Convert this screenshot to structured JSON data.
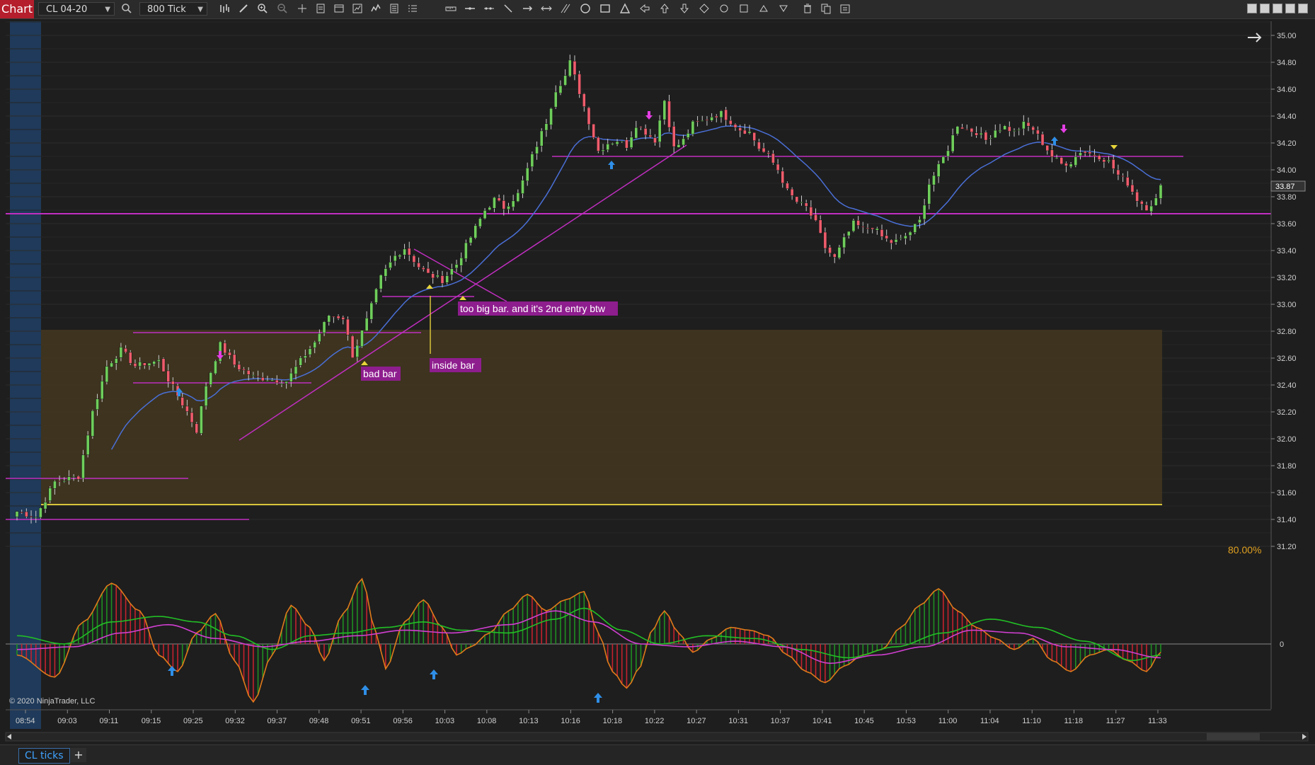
{
  "toolbar": {
    "brand": "Chart",
    "instrument": "CL 04-20",
    "interval": "800 Tick"
  },
  "tabs": [
    {
      "label": "CL ticks"
    }
  ],
  "copyright": "© 2020 NinjaTrader, LLC",
  "percent_label": "80.00%",
  "colors": {
    "background": "#1e1e1e",
    "up_candle": "#6fce5b",
    "down_candle": "#ef5c6c",
    "line_magenta": "#c02ec0",
    "fib_zone": "#3f3520",
    "sma": "#4a6fd6",
    "osc_orange": "#e07a1a",
    "osc_green": "#22c025",
    "osc_magenta": "#d13fd1"
  },
  "chart_data": {
    "type": "candlestick",
    "price_axis": {
      "ticks": [
        "35.00",
        "34.80",
        "34.60",
        "34.40",
        "34.20",
        "34.00",
        "33.80",
        "33.60",
        "33.40",
        "33.20",
        "33.00",
        "32.80",
        "32.60",
        "32.40",
        "32.20",
        "32.00",
        "31.80",
        "31.60",
        "31.40",
        "31.20"
      ],
      "range": [
        31.1,
        35.05
      ],
      "current_price": "33.87"
    },
    "time_axis": {
      "labels": [
        "08:54",
        "09:03",
        "09:11",
        "09:15",
        "09:25",
        "09:32",
        "09:37",
        "09:48",
        "09:51",
        "09:56",
        "10:03",
        "10:08",
        "10:13",
        "10:16",
        "10:18",
        "10:22",
        "10:27",
        "10:31",
        "10:37",
        "10:41",
        "10:45",
        "10:53",
        "11:00",
        "11:04",
        "11:10",
        "11:18",
        "11:27",
        "11:33"
      ]
    },
    "close_path": [
      [
        0,
        31.46
      ],
      [
        4,
        31.42
      ],
      [
        8,
        31.68
      ],
      [
        13,
        31.72
      ],
      [
        16,
        32.2
      ],
      [
        19,
        32.54
      ],
      [
        22,
        32.66
      ],
      [
        25,
        32.54
      ],
      [
        27,
        32.56
      ],
      [
        30,
        32.58
      ],
      [
        32,
        32.44
      ],
      [
        36,
        32.2
      ],
      [
        38,
        32.06
      ],
      [
        40,
        32.4
      ],
      [
        43,
        32.7
      ],
      [
        46,
        32.55
      ],
      [
        50,
        32.46
      ],
      [
        54,
        32.44
      ],
      [
        57,
        32.43
      ],
      [
        60,
        32.58
      ],
      [
        63,
        32.72
      ],
      [
        66,
        32.92
      ],
      [
        69,
        32.9
      ],
      [
        71,
        32.62
      ],
      [
        74,
        32.88
      ],
      [
        77,
        33.2
      ],
      [
        80,
        33.36
      ],
      [
        82,
        33.42
      ],
      [
        85,
        33.28
      ],
      [
        87,
        33.22
      ],
      [
        90,
        33.18
      ],
      [
        93,
        33.3
      ],
      [
        96,
        33.5
      ],
      [
        99,
        33.7
      ],
      [
        101,
        33.78
      ],
      [
        103,
        33.72
      ],
      [
        106,
        33.82
      ],
      [
        109,
        34.1
      ],
      [
        112,
        34.36
      ],
      [
        114,
        34.6
      ],
      [
        116,
        34.7
      ],
      [
        117,
        34.8
      ],
      [
        119,
        34.58
      ],
      [
        121,
        34.36
      ],
      [
        123,
        34.14
      ],
      [
        125,
        34.2
      ],
      [
        127,
        34.22
      ],
      [
        129,
        34.18
      ],
      [
        131,
        34.34
      ],
      [
        133,
        34.28
      ],
      [
        135,
        34.22
      ],
      [
        137,
        34.52
      ],
      [
        139,
        34.16
      ],
      [
        141,
        34.22
      ],
      [
        143,
        34.34
      ],
      [
        145,
        34.36
      ],
      [
        147,
        34.4
      ],
      [
        149,
        34.42
      ],
      [
        151,
        34.36
      ],
      [
        153,
        34.3
      ],
      [
        155,
        34.28
      ],
      [
        157,
        34.16
      ],
      [
        159,
        34.1
      ],
      [
        161,
        34.0
      ],
      [
        163,
        33.84
      ],
      [
        165,
        33.76
      ],
      [
        167,
        33.72
      ],
      [
        169,
        33.6
      ],
      [
        171,
        33.42
      ],
      [
        173,
        33.34
      ],
      [
        175,
        33.48
      ],
      [
        177,
        33.6
      ],
      [
        179,
        33.56
      ],
      [
        181,
        33.58
      ],
      [
        183,
        33.5
      ],
      [
        185,
        33.46
      ],
      [
        187,
        33.48
      ],
      [
        189,
        33.54
      ],
      [
        191,
        33.62
      ],
      [
        193,
        33.9
      ],
      [
        195,
        34.02
      ],
      [
        197,
        34.16
      ],
      [
        199,
        34.34
      ],
      [
        201,
        34.3
      ],
      [
        203,
        34.28
      ],
      [
        205,
        34.22
      ],
      [
        207,
        34.3
      ],
      [
        209,
        34.32
      ],
      [
        211,
        34.28
      ],
      [
        213,
        34.34
      ],
      [
        215,
        34.3
      ],
      [
        217,
        34.2
      ],
      [
        219,
        34.1
      ],
      [
        221,
        34.04
      ],
      [
        223,
        34.06
      ],
      [
        225,
        34.14
      ],
      [
        227,
        34.12
      ],
      [
        229,
        34.1
      ],
      [
        231,
        34.06
      ],
      [
        233,
        33.96
      ],
      [
        235,
        33.9
      ],
      [
        237,
        33.78
      ],
      [
        239,
        33.72
      ],
      [
        241,
        33.78
      ],
      [
        242,
        33.87
      ]
    ],
    "oscillator": {
      "zero_label": "0",
      "osc_points": [
        [
          0,
          -20
        ],
        [
          8,
          -60
        ],
        [
          14,
          40
        ],
        [
          20,
          110
        ],
        [
          26,
          60
        ],
        [
          30,
          -20
        ],
        [
          34,
          -50
        ],
        [
          38,
          20
        ],
        [
          42,
          55
        ],
        [
          46,
          -30
        ],
        [
          50,
          -105
        ],
        [
          54,
          -20
        ],
        [
          58,
          70
        ],
        [
          62,
          30
        ],
        [
          65,
          -30
        ],
        [
          69,
          55
        ],
        [
          73,
          118
        ],
        [
          76,
          20
        ],
        [
          78,
          -45
        ],
        [
          82,
          40
        ],
        [
          86,
          80
        ],
        [
          90,
          30
        ],
        [
          93,
          -20
        ],
        [
          96,
          -5
        ],
        [
          100,
          20
        ],
        [
          104,
          60
        ],
        [
          108,
          90
        ],
        [
          112,
          60
        ],
        [
          116,
          80
        ],
        [
          120,
          95
        ],
        [
          123,
          20
        ],
        [
          126,
          -50
        ],
        [
          129,
          -80
        ],
        [
          132,
          -40
        ],
        [
          134,
          20
        ],
        [
          137,
          60
        ],
        [
          140,
          20
        ],
        [
          143,
          -15
        ],
        [
          147,
          10
        ],
        [
          151,
          30
        ],
        [
          155,
          25
        ],
        [
          159,
          15
        ],
        [
          163,
          -20
        ],
        [
          167,
          -50
        ],
        [
          171,
          -70
        ],
        [
          175,
          -40
        ],
        [
          179,
          -20
        ],
        [
          183,
          -10
        ],
        [
          187,
          30
        ],
        [
          191,
          70
        ],
        [
          195,
          100
        ],
        [
          199,
          60
        ],
        [
          203,
          30
        ],
        [
          207,
          10
        ],
        [
          211,
          -10
        ],
        [
          215,
          10
        ],
        [
          219,
          -30
        ],
        [
          223,
          -50
        ],
        [
          227,
          -20
        ],
        [
          231,
          -10
        ],
        [
          235,
          -30
        ],
        [
          239,
          -50
        ],
        [
          242,
          -15
        ]
      ],
      "signal_points": [
        [
          0,
          15
        ],
        [
          10,
          0
        ],
        [
          20,
          40
        ],
        [
          30,
          50
        ],
        [
          38,
          40
        ],
        [
          46,
          15
        ],
        [
          54,
          -10
        ],
        [
          62,
          15
        ],
        [
          70,
          20
        ],
        [
          78,
          30
        ],
        [
          86,
          40
        ],
        [
          94,
          25
        ],
        [
          104,
          20
        ],
        [
          114,
          45
        ],
        [
          120,
          65
        ],
        [
          128,
          25
        ],
        [
          136,
          0
        ],
        [
          146,
          15
        ],
        [
          156,
          10
        ],
        [
          166,
          -10
        ],
        [
          176,
          -25
        ],
        [
          186,
          -5
        ],
        [
          196,
          20
        ],
        [
          206,
          45
        ],
        [
          216,
          30
        ],
        [
          226,
          5
        ],
        [
          236,
          -30
        ],
        [
          242,
          -20
        ]
      ],
      "trend_points": [
        [
          0,
          -10
        ],
        [
          12,
          -5
        ],
        [
          22,
          20
        ],
        [
          32,
          35
        ],
        [
          42,
          10
        ],
        [
          52,
          -5
        ],
        [
          62,
          5
        ],
        [
          72,
          15
        ],
        [
          82,
          25
        ],
        [
          92,
          20
        ],
        [
          104,
          35
        ],
        [
          114,
          60
        ],
        [
          122,
          40
        ],
        [
          132,
          0
        ],
        [
          142,
          -5
        ],
        [
          152,
          5
        ],
        [
          162,
          -5
        ],
        [
          172,
          -35
        ],
        [
          182,
          -20
        ],
        [
          192,
          -5
        ],
        [
          202,
          25
        ],
        [
          212,
          20
        ],
        [
          222,
          -5
        ],
        [
          232,
          -10
        ],
        [
          242,
          -25
        ]
      ]
    },
    "annotations": [
      {
        "text": "bad bar"
      },
      {
        "text": "inside bar"
      },
      {
        "text": "too big bar. and it's 2nd entry btw"
      }
    ]
  }
}
